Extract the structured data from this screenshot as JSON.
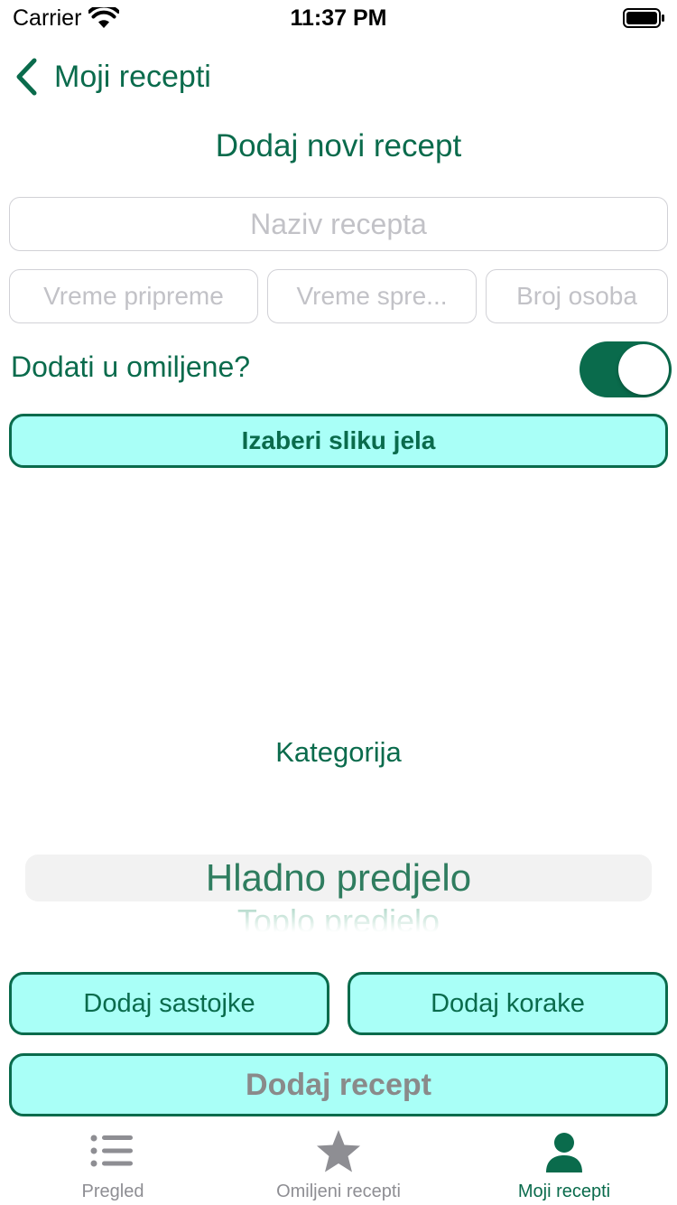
{
  "status_bar": {
    "carrier": "Carrier",
    "time": "11:37 PM",
    "icons": [
      "wifi-icon",
      "battery-icon"
    ]
  },
  "nav": {
    "back_label": "Moji recepti",
    "back_icon": "chevron-left-icon"
  },
  "page_title": "Dodaj novi recept",
  "form": {
    "name_placeholder": "Naziv recepta",
    "prep_time_placeholder": "Vreme pripreme",
    "cook_time_placeholder": "Vreme spre...",
    "persons_placeholder": "Broj osoba",
    "favorite_label": "Dodati u omiljene?",
    "favorite_on": true,
    "choose_image_label": "Izaberi sliku jela"
  },
  "category": {
    "label": "Kategorija",
    "selected": "Hladno predjelo",
    "next_option": "Toplo predjelo"
  },
  "buttons": {
    "add_ingredients": "Dodaj sastojke",
    "add_steps": "Dodaj korake",
    "add_recipe": "Dodaj recept"
  },
  "tab_bar": {
    "tabs": [
      {
        "label": "Pregled",
        "icon": "list-icon",
        "active": false
      },
      {
        "label": "Omiljeni recepti",
        "icon": "star-icon",
        "active": false
      },
      {
        "label": "Moji recepti",
        "icon": "person-icon",
        "active": true
      }
    ]
  },
  "colors": {
    "accent": "#0a6b4c",
    "button_fill": "#a9fff7",
    "placeholder": "#c2c2c7",
    "tab_inactive": "#8e8e93"
  }
}
